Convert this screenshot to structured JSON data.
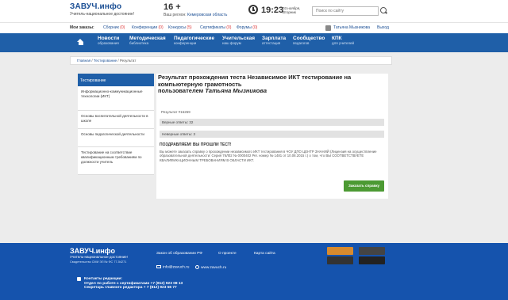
{
  "header": {
    "logo": "ЗАВУЧ.инфо",
    "tagline": "Учитель-национальное достояние!",
    "age": "16 +",
    "region_label": "Ваш регион:",
    "region": "Кемеровская область",
    "time": "19:23",
    "date": "03 ноября, Вторник",
    "search_placeholder": "Поиск по сайту"
  },
  "toplinks": {
    "label": "Мои заказы:",
    "items": [
      {
        "label": "Сборник",
        "count": "(0)"
      },
      {
        "label": "Конференции",
        "count": "(0)"
      },
      {
        "label": "Конкурсы",
        "count": "(5)"
      },
      {
        "label": "Сертификаты",
        "count": "(0)"
      },
      {
        "label": "Форумы",
        "count": "(0)"
      }
    ],
    "user": "Татьяна Мызникова",
    "logout": "Выход"
  },
  "nav": [
    {
      "title": "Новости",
      "sub": "образования"
    },
    {
      "title": "Методическая",
      "sub": "библиотека"
    },
    {
      "title": "Педагогические",
      "sub": "конференции"
    },
    {
      "title": "Учительская",
      "sub": "наш форум"
    },
    {
      "title": "Зарплата",
      "sub": "аттестация"
    },
    {
      "title": "Сообщество",
      "sub": "педагогов"
    },
    {
      "title": "КПК",
      "sub": "для учителей"
    }
  ],
  "breadcrumb": {
    "home": "Главная",
    "b1": "Тестирование",
    "b2": "Результат"
  },
  "sidebar": {
    "title": "Тестирование",
    "items": [
      "Информационно-коммуникационные технологии (ИКТ)",
      "Основы воспитательной деятельности в школе",
      "Основы педагогической деятельности",
      "Тестирование на соответствие квалификационным требованиям по должности учитель"
    ]
  },
  "main": {
    "title": "Результат прохождения теста Независимое ИКТ тестирование на компьютерную грамотность",
    "user_prefix": "пользователем",
    "user_name": "Татьяна Мызникова",
    "result_no": "Результат #16269",
    "correct": "Верные ответы: 32",
    "wrong": "Неверные ответы: 3",
    "congrats": "ПОЗДРАВЛЯЕМ! ВЫ ПРОШЛИ ТЕСТ!",
    "message": "Вы можете заказать справку о прохождении независимого ИКТ тестирования в ЧОУ ДПО ЦЕНТР ЗНАНИЙ (Лицензия на осуществление образовательной деятельности: Серия 76Л02 № 0000402 Рег. номер № 1481 от 10.08.2015 г.) о том, что ВЫ СООТВЕТСТВУЕТЕ КВАЛИФИКАЦИОННЫМ ТРЕБОВАНИЯМ В ОБЛАСТИ ИКТ.",
    "order_button": "Заказать справку"
  },
  "footer": {
    "logo": "ЗАВУЧ.инфо",
    "tagline": "Учитель-национальное достояние!",
    "reg": "Свидетельство СМИ ЭЛ № ФС 77-54271",
    "links": [
      "Закон об образовании РФ",
      "О проекте",
      "Карта сайта"
    ],
    "email": "info@zavuch.ru",
    "site": "www.zavuch.ru",
    "contacts_title": "Контакты редакции:",
    "contact1": "Отдел по работе с сертификатами +7 (812) 923 08 13",
    "contact2": "Секретарь главного редактора + 7 (812) 923 56 77"
  }
}
